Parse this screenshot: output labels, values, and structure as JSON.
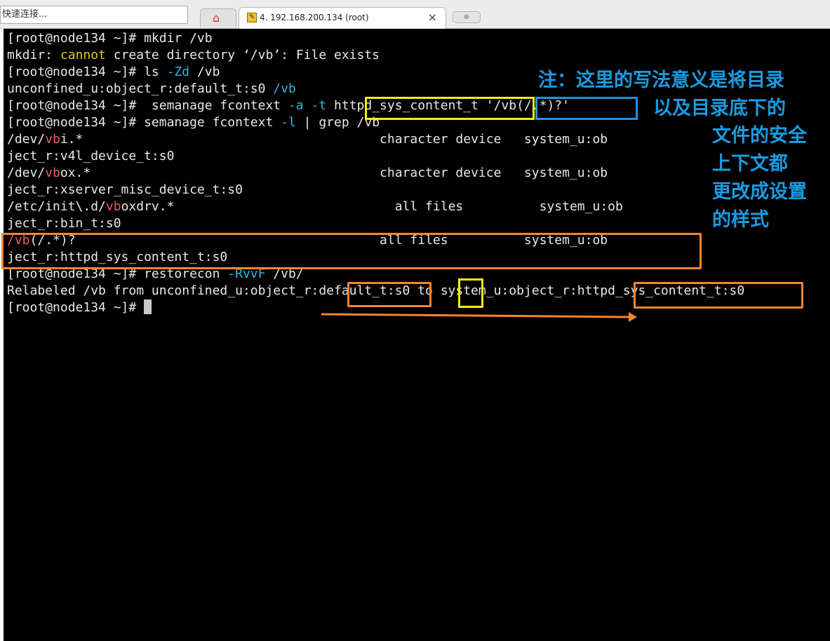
{
  "quick_connect": {
    "text": "快速连接..."
  },
  "tabs": [
    {
      "label": "4. 192.168.200.134 (root)",
      "active": true
    }
  ],
  "terminal": {
    "lines": [
      [
        [
          "[root@node134 ~]# mkdir /vb",
          ""
        ]
      ],
      [
        [
          "mkdir: ",
          ""
        ],
        [
          "cannot",
          "yl"
        ],
        [
          " create directory ‘/vb’: File exists",
          ""
        ]
      ],
      [
        [
          "[root@node134 ~]# ls ",
          ""
        ],
        [
          "-Zd",
          "cy"
        ],
        [
          " /vb",
          ""
        ]
      ],
      [
        [
          "unconfined_u:object_r:default_t:s0 ",
          ""
        ],
        [
          "/vb",
          "cy"
        ]
      ],
      [
        [
          "[root@node134 ~]#  semanage fcontext ",
          ""
        ],
        [
          "-a",
          "cy"
        ],
        [
          " ",
          ""
        ],
        [
          "-t",
          "cy"
        ],
        [
          " httpd_sys_content_t '/vb(/.*)?'",
          ""
        ]
      ],
      [
        [
          "[root@node134 ~]# semanage fcontext ",
          ""
        ],
        [
          "-l",
          "cy"
        ],
        [
          " | grep /vb",
          ""
        ]
      ],
      [
        [
          "/dev/",
          ""
        ],
        [
          "vb",
          "rd"
        ],
        [
          "i.*                                       character device   system_u:ob",
          ""
        ]
      ],
      [
        [
          "ject_r:v4l_device_t:s0",
          ""
        ]
      ],
      [
        [
          "/dev/",
          ""
        ],
        [
          "vb",
          "rd"
        ],
        [
          "ox.*                                      character device   system_u:ob",
          ""
        ]
      ],
      [
        [
          "ject_r:xserver_misc_device_t:s0",
          ""
        ]
      ],
      [
        [
          "/etc/init\\.d/",
          ""
        ],
        [
          "vb",
          "rd"
        ],
        [
          "oxdrv.*                             all files          system_u:ob",
          ""
        ]
      ],
      [
        [
          "ject_r:bin_t:s0",
          ""
        ]
      ],
      [
        [
          "/vb",
          "rd"
        ],
        [
          "(/.*)?                                        all files          system_u:ob",
          ""
        ]
      ],
      [
        [
          "ject_r:httpd_sys_content_t:s0",
          ""
        ]
      ],
      [
        [
          "[root@node134 ~]# restorecon ",
          ""
        ],
        [
          "-RvvF",
          "cy"
        ],
        [
          " /vb/",
          ""
        ]
      ],
      [
        [
          "Relabeled /vb from unconfined_u:object_r:default_t:s0 to system_u:object_r:httpd_sys_content_t:s0",
          ""
        ]
      ],
      [
        [
          "[root@node134 ~]# ",
          ""
        ]
      ]
    ]
  },
  "annotation": {
    "line1": "注：这里的写法意义是将目录",
    "line2": "以及目录底下的",
    "line3": "文件的安全",
    "line4": "上下文都",
    "line5": "更改成设置",
    "line6": "的样式"
  },
  "colors": {
    "annotation": "#1a9be2",
    "highlight_yellow": "#f6ee14",
    "highlight_blue": "#1f94e6",
    "highlight_orange": "#f5862b"
  }
}
